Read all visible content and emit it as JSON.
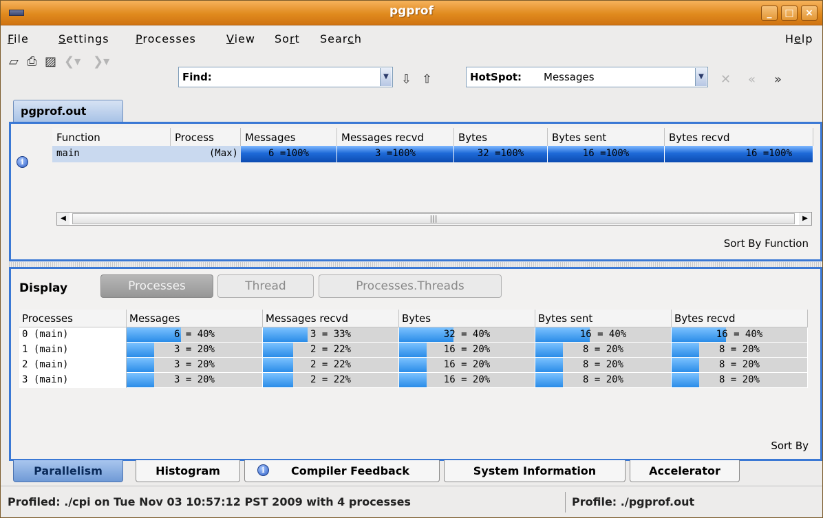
{
  "window": {
    "title": "pgprof"
  },
  "menu": [
    {
      "pre": "",
      "u": "F",
      "post": "ile"
    },
    {
      "pre": "",
      "u": "S",
      "post": "ettings"
    },
    {
      "pre": "",
      "u": "P",
      "post": "rocesses"
    },
    {
      "pre": "",
      "u": "V",
      "post": "iew"
    },
    {
      "pre": "So",
      "u": "r",
      "post": "t"
    },
    {
      "pre": "Sear",
      "u": "c",
      "post": "h"
    },
    {
      "pre": "H",
      "u": "e",
      "post": "lp"
    }
  ],
  "toolbar": {
    "find_label": "Find:",
    "find_value": "",
    "hotspot_label": "HotSpot:",
    "hotspot_value": "Messages"
  },
  "doc_tab": "pgprof.out",
  "top_table": {
    "headers": [
      "Function",
      "Process",
      "Messages",
      "Messages recvd",
      "Bytes",
      "Bytes sent",
      "Bytes recvd"
    ],
    "row": {
      "function": "main",
      "process": "(Max)",
      "messages": "6 =100%",
      "messages_recvd": "3 =100%",
      "bytes": "32 =100%",
      "bytes_sent": "16 =100%",
      "bytes_recvd": "16 =100%"
    },
    "sort_label": "Sort By Function"
  },
  "display": {
    "label": "Display",
    "buttons": [
      "Processes",
      "Thread",
      "Processes.Threads"
    ],
    "active": "Processes"
  },
  "process_table": {
    "headers": [
      "Processes",
      "Messages",
      "Messages recvd",
      "Bytes",
      "Bytes sent",
      "Bytes recvd"
    ],
    "rows": [
      {
        "proc": "0  (main)",
        "cells": [
          {
            "text": "6 = 40%",
            "fill": 0.4
          },
          {
            "text": "3 = 33%",
            "fill": 0.33
          },
          {
            "text": "32 = 40%",
            "fill": 0.4
          },
          {
            "text": "16 = 40%",
            "fill": 0.4
          },
          {
            "text": "16 = 40%",
            "fill": 0.4
          }
        ]
      },
      {
        "proc": "1  (main)",
        "cells": [
          {
            "text": "3 = 20%",
            "fill": 0.2
          },
          {
            "text": "2 = 22%",
            "fill": 0.22
          },
          {
            "text": "16 = 20%",
            "fill": 0.2
          },
          {
            "text": "8 = 20%",
            "fill": 0.2
          },
          {
            "text": "8 = 20%",
            "fill": 0.2
          }
        ]
      },
      {
        "proc": "2  (main)",
        "cells": [
          {
            "text": "3 = 20%",
            "fill": 0.2
          },
          {
            "text": "2 = 22%",
            "fill": 0.22
          },
          {
            "text": "16 = 20%",
            "fill": 0.2
          },
          {
            "text": "8 = 20%",
            "fill": 0.2
          },
          {
            "text": "8 = 20%",
            "fill": 0.2
          }
        ]
      },
      {
        "proc": "3  (main)",
        "cells": [
          {
            "text": "3 = 20%",
            "fill": 0.2
          },
          {
            "text": "2 = 22%",
            "fill": 0.22
          },
          {
            "text": "16 = 20%",
            "fill": 0.2
          },
          {
            "text": "8 = 20%",
            "fill": 0.2
          },
          {
            "text": "8 = 20%",
            "fill": 0.2
          }
        ]
      }
    ],
    "sort_label": "Sort By"
  },
  "bottom_tabs": [
    "Parallelism",
    "Histogram",
    "Compiler Feedback",
    "System Information",
    "Accelerator"
  ],
  "active_bottom_tab": "Parallelism",
  "status": {
    "left": "Profiled: ./cpi on Tue Nov 03 10:57:12 PST 2009 with 4 processes",
    "right": "Profile: ./pgprof.out"
  },
  "colors": {
    "accent": "#3a78d4",
    "titlebar": "#e08a1e",
    "bar": "#2a8ce8"
  }
}
